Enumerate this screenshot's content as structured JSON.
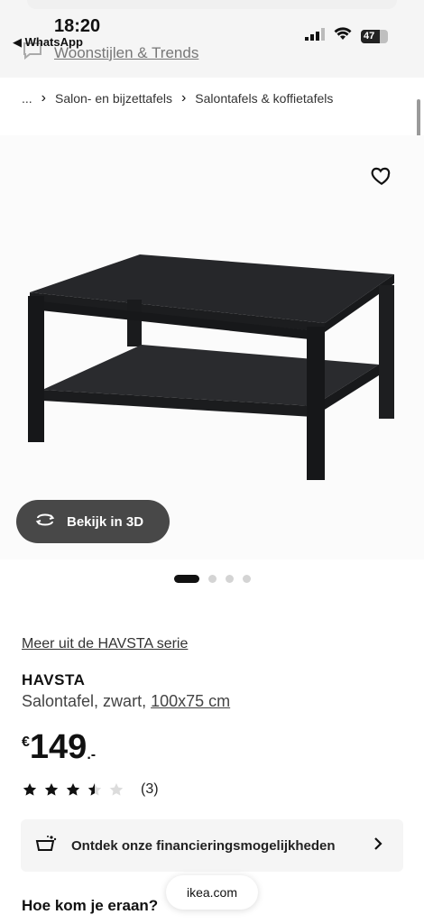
{
  "status": {
    "time": "18:20",
    "back_app": "◀ WhatsApp",
    "battery": "47"
  },
  "top_link": "Woonstijlen & Trends",
  "breadcrumb": {
    "ellipsis": "...",
    "level1": "Salon- en bijzettafels",
    "level2": "Salontafels & koffietafels"
  },
  "view3d": {
    "label": "Bekijk in 3D"
  },
  "carousel": {
    "total": 4,
    "active": 1
  },
  "product": {
    "series_link": "Meer uit de HAVSTA serie",
    "name": "HAVSTA",
    "desc": "Salontafel, zwart,",
    "size": "100x75 cm",
    "price_currency": "€",
    "price_main": "149",
    "price_decimals": ".-",
    "rating": 3.5,
    "rating_max": 5,
    "review_count": "(3)"
  },
  "finance": {
    "label": "Ontdek onze financieringsmogelijkheden"
  },
  "next_heading": "Hoe kom je eraan?",
  "url": "ikea.com",
  "colors": {
    "dark_button": "#484848",
    "finance_bg": "#f5f5f5",
    "product_black": "#232426"
  }
}
